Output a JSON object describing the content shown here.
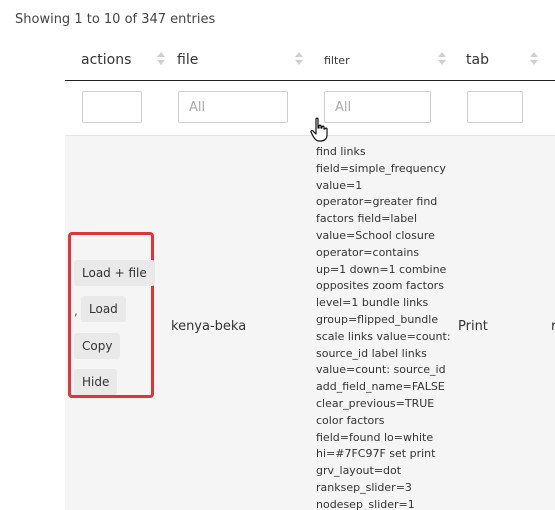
{
  "info_text": "Showing 1 to 10 of 347 entries",
  "columns": [
    {
      "label": "actions"
    },
    {
      "label": "file"
    },
    {
      "label": "filter"
    },
    {
      "label": "tab"
    }
  ],
  "filters": {
    "actions_value": "",
    "file_placeholder": "All",
    "filter_placeholder": "All",
    "tab_value": ""
  },
  "row": {
    "buttons": {
      "load_file": "Load + file",
      "separator": ",",
      "load": "Load",
      "copy": "Copy",
      "hide": "Hide"
    },
    "file": "kenya-beka",
    "filter_lines": [
      "find links",
      "field=simple_frequency",
      "value=1",
      "operator=greater find",
      "factors field=label",
      "value=School closure",
      "operator=contains",
      "up=1 down=1 combine",
      "opposites zoom factors",
      "level=1 bundle links",
      "group=flipped_bundle",
      "scale links value=count:",
      "source_id label links",
      "value=count: source_id",
      "add_field_name=FALSE",
      "clear_previous=TRUE",
      "color factors",
      "field=found lo=white",
      "hi=#7FC97F set print",
      "grv_layout=dot",
      "ranksep_slider=3",
      "nodesep_slider=1"
    ],
    "tab": "Print",
    "next_col_fragment": "r"
  },
  "colors": {
    "highlight": "#d9373a",
    "row_background": "#f5f5f5",
    "button_background": "#e9e9e9"
  }
}
